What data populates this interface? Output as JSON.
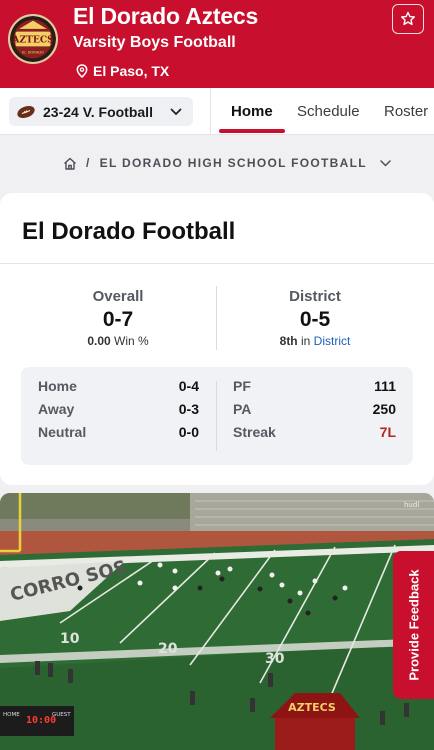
{
  "header": {
    "team_name": "El Dorado Aztecs",
    "team_subtitle": "Varsity Boys Football",
    "location": "El Paso, TX",
    "logo_text": "AZTECS",
    "logo_subtext": "EL DORADO",
    "accent_color": "#c8102e"
  },
  "subnav": {
    "season": "23-24 V. Football",
    "tabs": [
      "Home",
      "Schedule",
      "Roster"
    ],
    "active_tab": "Home"
  },
  "breadcrumb": {
    "separator": "/",
    "label": "EL DORADO HIGH SCHOOL FOOTBALL"
  },
  "card": {
    "title": "El Dorado Football",
    "overall": {
      "label": "Overall",
      "record": "0-7",
      "win_pct": "0.00",
      "win_pct_label": "Win %"
    },
    "district": {
      "label": "District",
      "record": "0-5",
      "rank": "8th",
      "rank_in": "in",
      "rank_link": "District"
    },
    "splits": [
      {
        "label": "Home",
        "value": "0-4"
      },
      {
        "label": "Away",
        "value": "0-3"
      },
      {
        "label": "Neutral",
        "value": "0-0"
      }
    ],
    "totals": [
      {
        "label": "PF",
        "value": "111"
      },
      {
        "label": "PA",
        "value": "250"
      },
      {
        "label": "Streak",
        "value": "7L"
      }
    ]
  },
  "video": {
    "scoreboard_home": "HOME",
    "scoreboard_guest": "GUEST",
    "scoreboard_clock": "10:00",
    "watermark": "hudl",
    "tent_text": "AZTECS",
    "yard_labels": [
      "10",
      "20",
      "30"
    ],
    "endzone_text": "CORRO SOS"
  },
  "feedback_label": "Provide Feedback"
}
